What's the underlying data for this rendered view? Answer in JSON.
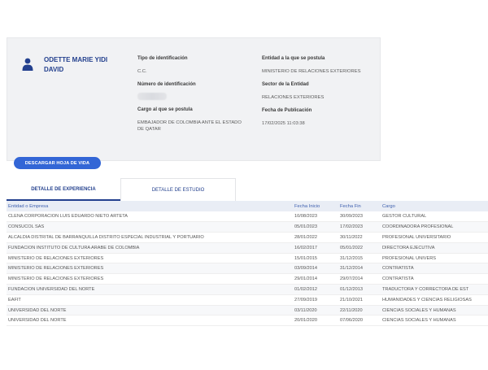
{
  "profile": {
    "name": "ODETTE MARIE YIDI DAVID",
    "fields": {
      "tipo_label": "Tipo de identificación",
      "tipo_value": "C.C.",
      "numero_label": "Número de identificación",
      "cargo_label": "Cargo al que se postula",
      "cargo_value": "EMBAJADOR DE COLOMBIA ANTE EL ESTADO DE QATAR",
      "entidad_label": "Entidad a la que se postula",
      "entidad_value": "MINISTERIO DE RELACIONES EXTERIORES",
      "sector_label": "Sector de la Entidad",
      "sector_value": "RELACIONES EXTERIORES",
      "fecha_label": "Fecha de Publicación",
      "fecha_value": "17/02/2025 11:03:38"
    }
  },
  "download_label": "DESCARGAR HOJA DE VIDA",
  "tabs": [
    {
      "label": "DETALLE DE EXPERIENCIA",
      "active": true
    },
    {
      "label": "DETALLE DE ESTUDIO",
      "active": false
    }
  ],
  "table": {
    "headers": [
      "Entidad o Empresa",
      "Fecha Inicio",
      "Fecha Fin",
      "Cargo"
    ],
    "rows": [
      [
        "CLENA CORPORACION LUIS EDUARDO NIETO ARTETA",
        "10/08/2023",
        "30/09/2023",
        "GESTOR CULTURAL"
      ],
      [
        "CONSUCOL SAS",
        "05/01/2023",
        "17/02/2023",
        "COORDINADORA PROFESIONAL"
      ],
      [
        "ALCALDIA DISTRITAL DE BARRANQUILLA DISTRITO ESPECIAL INDUSTRIAL Y PORTUARIO",
        "28/01/2022",
        "30/11/2022",
        "PROFESIONAL UNIVERSITARIO"
      ],
      [
        "FUNDACION INSTITUTO DE CULTURA ARABE DE COLOMBIA",
        "16/02/2017",
        "05/01/2022",
        "DIRECTORA EJECUTIVA"
      ],
      [
        "MINISTERIO DE RELACIONES EXTERIORES",
        "15/01/2015",
        "31/12/2015",
        "PROFESIONAL UNIVERS"
      ],
      [
        "MINISTERIO DE RELACIONES EXTERIORES",
        "03/09/2014",
        "31/12/2014",
        "CONTRATISTA"
      ],
      [
        "MINISTERIO DE RELACIONES EXTERIORES",
        "29/01/2014",
        "29/07/2014",
        "CONTRATISTA"
      ],
      [
        "FUNDACION UNIVERSIDAD DEL NORTE",
        "01/02/2012",
        "01/12/2013",
        "TRADUCTORA Y CORRECTORA DE EST"
      ],
      [
        "EAFIT",
        "27/09/2019",
        "21/10/2021",
        "HUMANIDADES Y CIENCIAS RELIGIOSAS"
      ],
      [
        "UNIVERSIDAD DEL NORTE",
        "03/11/2020",
        "22/11/2020",
        "CIENCIAS SOCIALES Y HUMANAS"
      ],
      [
        "UNIVERSIDAD DEL NORTE",
        "20/01/2020",
        "07/06/2020",
        "CIENCIAS SOCIALES Y HUMANAS"
      ]
    ]
  },
  "colors": {
    "accent": "#23408e",
    "button": "#3366d6",
    "card_bg": "#f1f2f4"
  }
}
